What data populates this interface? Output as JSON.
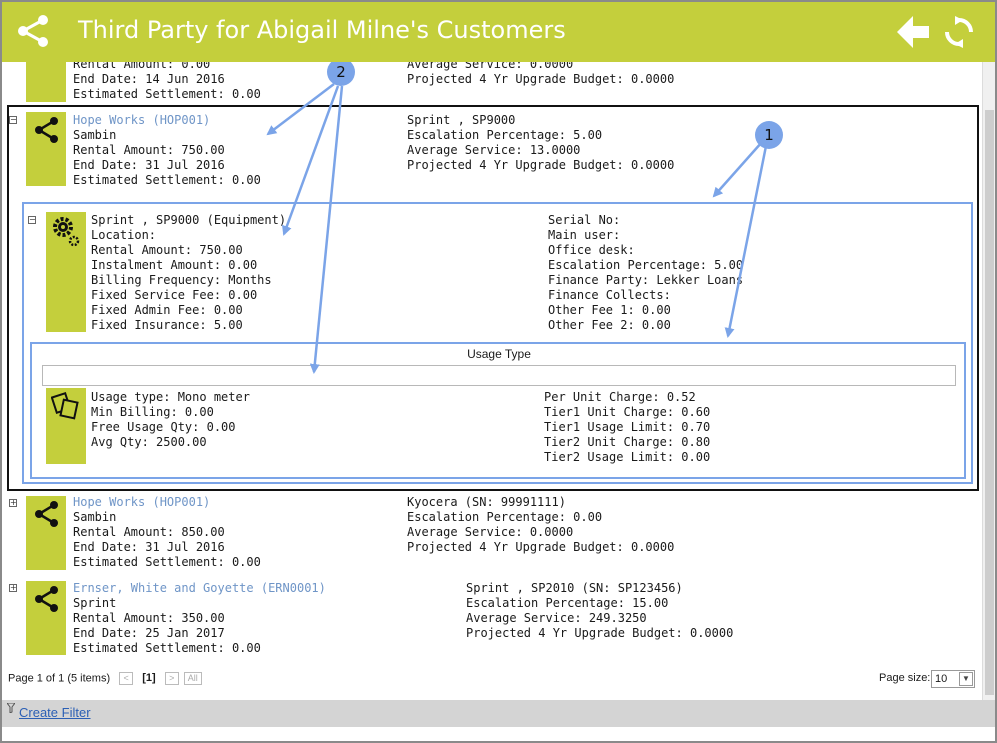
{
  "header": {
    "title": "Third Party for Abigail Milne's Customers"
  },
  "top_partial": {
    "left": [
      "Rental Amount: 0.00",
      "End Date: 14 Jun 2016",
      "Estimated Settlement: 0.00"
    ],
    "right": [
      "Average Service: 0.0000",
      "Projected 4 Yr Upgrade Budget: 0.0000"
    ]
  },
  "record1": {
    "name": "Hope Works (HOP001)",
    "left": [
      "Sambin",
      "Rental Amount: 750.00",
      "End Date: 31 Jul 2016",
      "Estimated Settlement: 0.00"
    ],
    "right": [
      "Sprint , SP9000",
      "Escalation Percentage: 5.00",
      "Average Service: 13.0000",
      "Projected 4 Yr Upgrade Budget: 0.0000"
    ]
  },
  "equipment": {
    "left": [
      "Sprint , SP9000 (Equipment)",
      "Location:",
      "Rental Amount: 750.00",
      "Instalment Amount: 0.00",
      "Billing Frequency: Months",
      "Fixed Service Fee: 0.00",
      "Fixed Admin Fee: 0.00",
      "Fixed Insurance: 5.00"
    ],
    "right": [
      "Serial No:",
      "Main user:",
      "Office desk:",
      "Escalation Percentage: 5.00",
      "Finance Party: Lekker Loans",
      "Finance Collects:",
      "Other Fee 1: 0.00",
      "Other Fee 2: 0.00"
    ]
  },
  "usage": {
    "header": "Usage Type",
    "left": [
      "Usage type: Mono meter",
      "Min Billing: 0.00",
      "Free Usage Qty: 0.00",
      "Avg Qty: 2500.00"
    ],
    "right": [
      "Per Unit Charge: 0.52",
      "Tier1 Unit Charge: 0.60",
      "Tier1 Usage Limit: 0.70",
      "Tier2 Unit Charge: 0.80",
      "Tier2 Usage Limit: 0.00"
    ]
  },
  "record2": {
    "name": "Hope Works (HOP001)",
    "left": [
      "Sambin",
      "Rental Amount: 850.00",
      "End Date: 31 Jul 2016",
      "Estimated Settlement: 0.00"
    ],
    "right": [
      "Kyocera (SN: 99991111)",
      "Escalation Percentage: 0.00",
      "Average Service: 0.0000",
      "Projected 4 Yr Upgrade Budget: 0.0000"
    ]
  },
  "record3": {
    "name": "Ernser, White and Goyette (ERN0001)",
    "left": [
      "Sprint",
      "Rental Amount: 350.00",
      "End Date: 25 Jan 2017",
      "Estimated Settlement: 0.00"
    ],
    "right": [
      "Sprint , SP2010 (SN: SP123456)",
      "Escalation Percentage: 15.00",
      "Average Service: 249.3250",
      "Projected 4 Yr Upgrade Budget: 0.0000"
    ]
  },
  "callouts": {
    "one": "1",
    "two": "2"
  },
  "pager": {
    "info": "Page 1 of 1 (5 items)",
    "prev": "<",
    "current": "[1]",
    "next": ">",
    "all": "All",
    "page_size_label": "Page size:",
    "page_size_value": "10"
  },
  "footer": {
    "create_filter": "Create Filter"
  },
  "colors": {
    "brand": "#c4cf3c",
    "callout": "#7ba4e8",
    "link": "#6f95c7"
  }
}
